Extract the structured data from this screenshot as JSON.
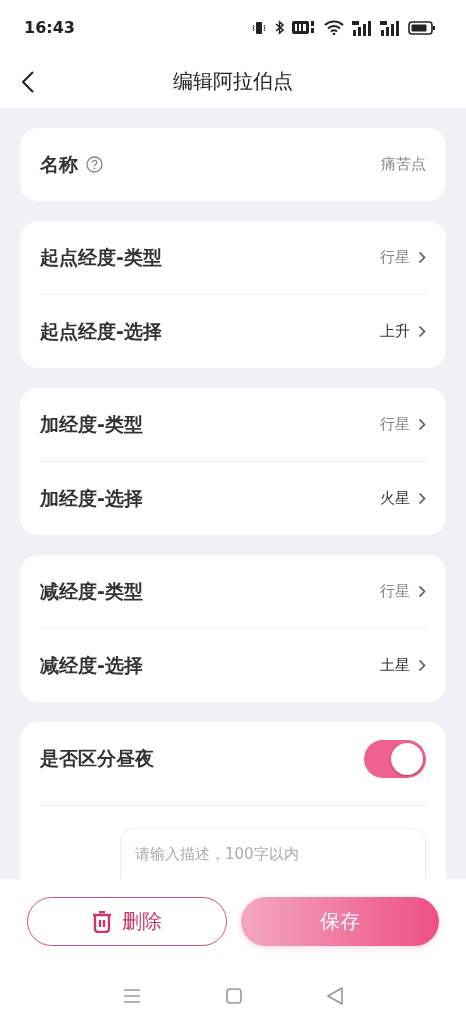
{
  "status_bar": {
    "time": "16:43"
  },
  "header": {
    "title": "编辑阿拉伯点"
  },
  "name_field": {
    "label": "名称",
    "value": "痛苦点"
  },
  "groups": [
    {
      "rows": [
        {
          "kind": "type",
          "label": "起点经度-类型",
          "value": "行星"
        },
        {
          "kind": "choice",
          "label": "起点经度-选择",
          "value": "上升"
        }
      ]
    },
    {
      "rows": [
        {
          "kind": "type",
          "label": "加经度-类型",
          "value": "行星"
        },
        {
          "kind": "choice",
          "label": "加经度-选择",
          "value": "火星"
        }
      ]
    },
    {
      "rows": [
        {
          "kind": "type",
          "label": "减经度-类型",
          "value": "行星"
        },
        {
          "kind": "choice",
          "label": "减经度-选择",
          "value": "土星"
        }
      ]
    }
  ],
  "day_night": {
    "label": "是否区分昼夜",
    "on": true,
    "description": {
      "placeholder": "请输入描述，100字以内"
    }
  },
  "buttons": [
    {
      "kind": "delete",
      "label": "删除"
    },
    {
      "kind": "save",
      "label": "保存"
    }
  ]
}
